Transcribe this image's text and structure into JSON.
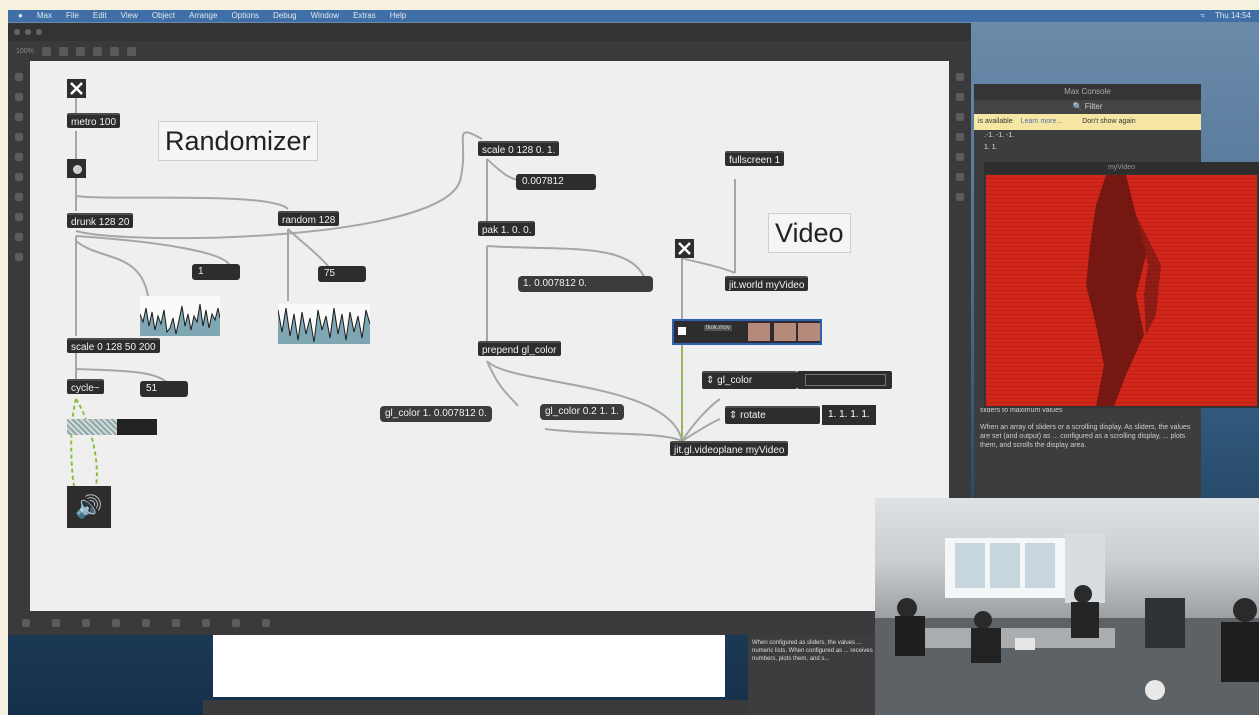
{
  "menubar": {
    "items": [
      "Max",
      "File",
      "Edit",
      "View",
      "Object",
      "Arrange",
      "Options",
      "Debug",
      "Window",
      "Extras",
      "Help"
    ],
    "status": [
      "Thu 14:54"
    ]
  },
  "max_window": {
    "title": "",
    "zoom": "100%"
  },
  "patch": {
    "objects": {
      "metro": "metro 100",
      "drunk": "drunk 128 20",
      "random": "random 128",
      "scale1": "scale 0 128 50 200",
      "cycle": "cycle~",
      "scale2": "scale 0 128 0. 1.",
      "pak": "pak 1. 0. 0.",
      "prepend": "prepend gl_color",
      "fullscreen": "fullscreen 1",
      "jitworld": "jit.world myVideo",
      "gl_color_obj": "gl_color",
      "rotate": "rotate",
      "videoplane": "jit.gl.videoplane myVideo"
    },
    "numbers": {
      "n_one": "1",
      "n_75": "75",
      "n_51": "51",
      "n_float": "0.007812"
    },
    "messages": {
      "pak_out": "1. 0.007812 0.",
      "gl_color1": "gl_color 1. 0.007812 0.",
      "gl_color2": "gl_color 0.2 1. 1.",
      "rotate_vals": "1.  1.  1.  1."
    },
    "comments": {
      "randomizer": "Randomizer",
      "video": "Video"
    },
    "player_label": "tkok.mov"
  },
  "console": {
    "title": "Max Console",
    "filter": "Filter",
    "warning": "is available",
    "learn_more": "Learn more...",
    "dont_show": "Don't show again",
    "rows": [
      ".-1. -1. -1.",
      "1. 1."
    ],
    "doc_heading": "sliders to maximum values",
    "doc_body": "When an array of sliders or a scrolling display. As sliders, the values are set (and output) as ... configured as a scrolling display, ... plots them, and scrolls the display area."
  },
  "reference": {
    "text": "When configured as sliders, the values ... numeric lists. When configured as ... receives numbers, plots them, and s..."
  },
  "video_window": {
    "title": "myVideo"
  },
  "colors": {
    "object_bg": "#2d2d2d",
    "canvas_bg": "#efefef",
    "video_red": "#d1271b",
    "selection_blue": "#2e62b3",
    "patchcord_green": "#8bbf3e"
  }
}
